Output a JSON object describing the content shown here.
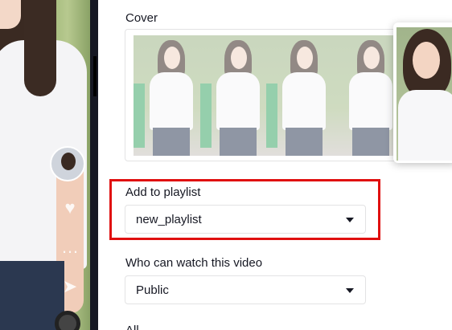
{
  "cover": {
    "label": "Cover",
    "frames": [
      1,
      2,
      3,
      4
    ]
  },
  "playlist": {
    "label": "Add to playlist",
    "selected": "new_playlist"
  },
  "privacy": {
    "label": "Who can watch this video",
    "selected": "Public"
  },
  "allow": {
    "label": "All"
  },
  "highlight_color": "#e01010",
  "icons": [
    "heart-icon",
    "comment-icon",
    "share-icon",
    "chevron-down-icon"
  ]
}
